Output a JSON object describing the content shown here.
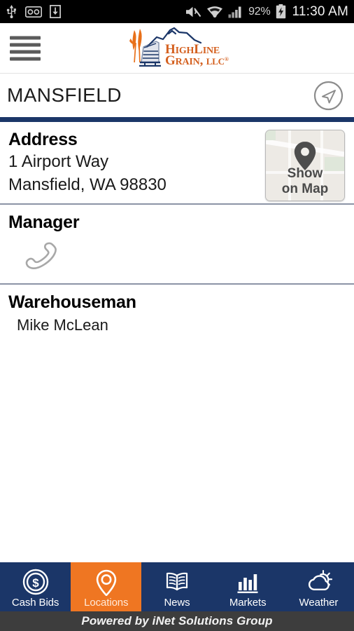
{
  "status_bar": {
    "left_icons": [
      "usb-icon",
      "voicemail-icon",
      "download-icon"
    ],
    "right_icons": [
      "mute-icon",
      "wifi-icon",
      "signal-icon",
      "battery-charging-icon"
    ],
    "battery_percent": "92%",
    "time": "11:30 AM"
  },
  "app_bar": {
    "menu_icon": "hamburger-menu-icon",
    "logo_line1": "HighLine",
    "logo_line2": "Grain, LLC",
    "logo_registered": "®",
    "logo_color_text": "#d4601f",
    "logo_color_mountain": "#1b3668"
  },
  "title_bar": {
    "title": "MANSFIELD",
    "directions_icon": "navigation-arrow-icon",
    "accent_color": "#1b3668"
  },
  "sections": {
    "address": {
      "heading": "Address",
      "street": "1 Airport Way",
      "city_state_zip": "Mansfield, WA 98830",
      "map_button": {
        "icon": "map-pin-icon",
        "line1": "Show",
        "line2": "on Map"
      }
    },
    "manager": {
      "heading": "Manager",
      "name": "",
      "phone_icon": "phone-handset-icon"
    },
    "warehouseman": {
      "heading": "Warehouseman",
      "name": "Mike McLean"
    }
  },
  "bottom_nav": {
    "active_color": "#ef7622",
    "bar_color": "#1b3668",
    "items": [
      {
        "label": "Cash Bids",
        "icon": "dollar-coin-icon",
        "active": false
      },
      {
        "label": "Locations",
        "icon": "map-pin-icon",
        "active": true
      },
      {
        "label": "News",
        "icon": "open-book-icon",
        "active": false
      },
      {
        "label": "Markets",
        "icon": "bar-chart-icon",
        "active": false
      },
      {
        "label": "Weather",
        "icon": "sun-cloud-icon",
        "active": false
      }
    ]
  },
  "footer": {
    "text": "Powered by iNet Solutions Group"
  }
}
